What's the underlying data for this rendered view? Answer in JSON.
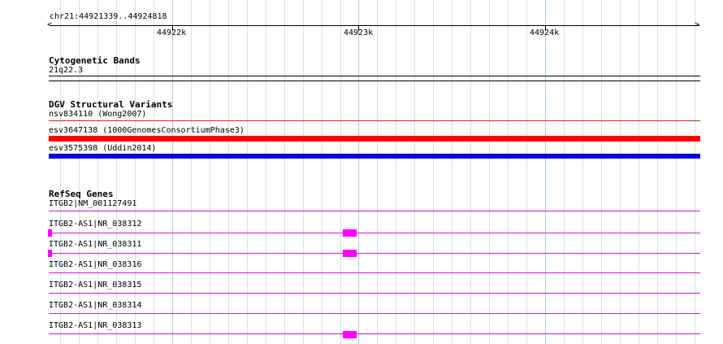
{
  "ruler": {
    "location": "chr21:44921339..44924818",
    "ticks": [
      "44922k",
      "44923k",
      "44924k"
    ]
  },
  "cytoband": {
    "title": "Cytogenetic Bands",
    "band": "21q22.3"
  },
  "dgv": {
    "title": "DGV Structural Variants",
    "features": [
      {
        "label": "nsv834110 (Wong2007)",
        "color": "#e02020"
      },
      {
        "label": "esv3647138 (1000GenomesConsortiumPhase3)",
        "color": "#ff0000"
      },
      {
        "label": "esv3575398 (Uddin2014)",
        "color": "#0000e0"
      }
    ]
  },
  "refseq": {
    "title": "RefSeq Genes",
    "color": "#ff00ff",
    "genes": [
      {
        "label": "ITGB2|NM_001127491"
      },
      {
        "label": "ITGB2-AS1|NR_038312"
      },
      {
        "label": "ITGB2-AS1|NR_038311"
      },
      {
        "label": "ITGB2-AS1|NR_038316"
      },
      {
        "label": "ITGB2-AS1|NR_038315"
      },
      {
        "label": "ITGB2-AS1|NR_038314"
      },
      {
        "label": "ITGB2-AS1|NR_038313"
      }
    ]
  }
}
